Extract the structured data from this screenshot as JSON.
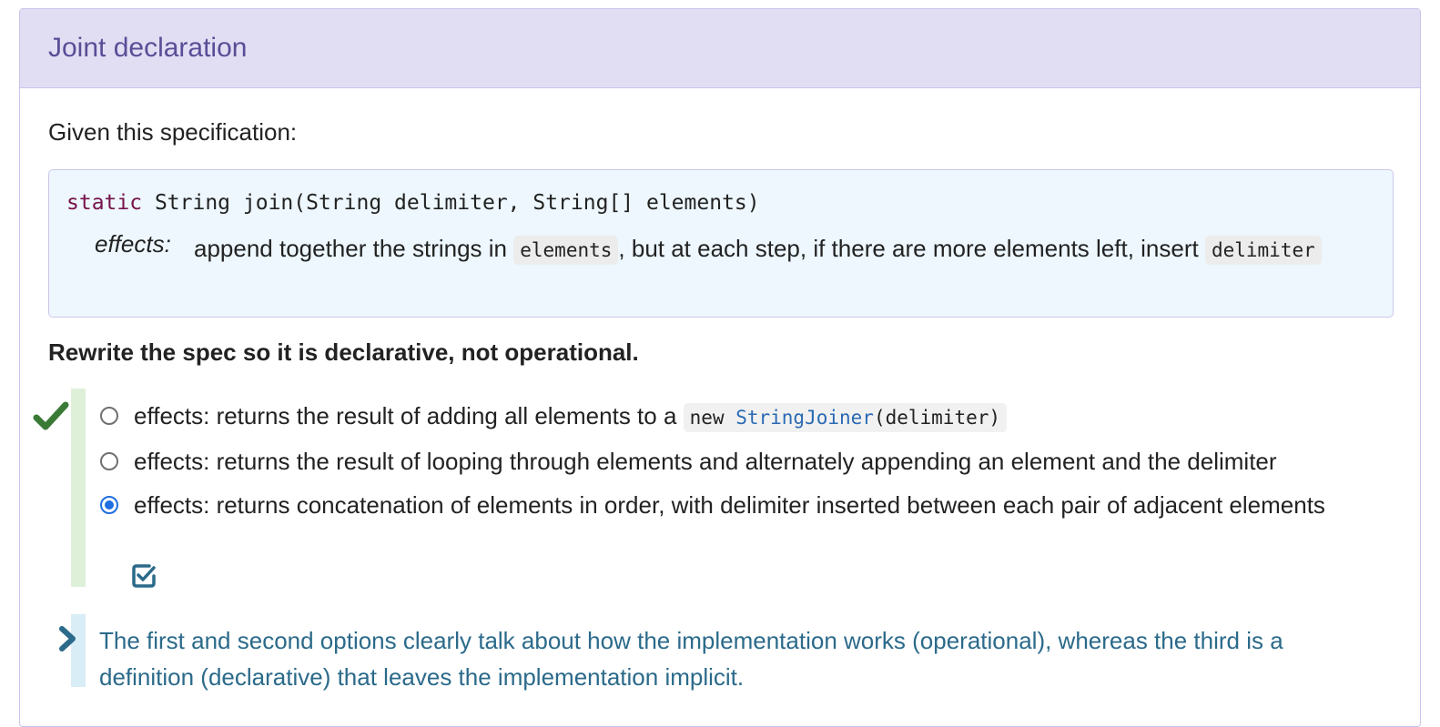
{
  "panel": {
    "title": "Joint declaration"
  },
  "intro": "Given this specification:",
  "spec": {
    "keyword": "static",
    "signature_rest": " String join(String delimiter, String[] elements)",
    "effects_label": "effects:",
    "effects_part1": "append together the strings in ",
    "effects_code1": "elements",
    "effects_part2": ", but at each step, if there are more elements left, insert ",
    "effects_code2": "delimiter"
  },
  "question": "Rewrite the spec so it is declarative, not operational.",
  "options": [
    {
      "text": "effects: returns the result of adding all elements to a ",
      "code_new": "new ",
      "code_class": "StringJoiner",
      "code_args": "(delimiter)",
      "selected": false
    },
    {
      "text": "effects: returns the result of looping through elements and alternately appending an element and the delimiter",
      "selected": false
    },
    {
      "text": "effects: returns concatenation of elements in order, with delimiter inserted between each pair of adjacent elements",
      "selected": true
    }
  ],
  "result": {
    "status": "correct",
    "status_color": "#3a7a36"
  },
  "explanation": "The first and second options clearly talk about how the implementation works (operational), whereas the third is a definition (declarative) that leaves the implementation implicit.",
  "icons": {
    "correct": "check-icon",
    "submit": "check-square-icon",
    "expand": "chevron-right-icon"
  },
  "colors": {
    "header_bg": "#e1def4",
    "title": "#5a4d96",
    "spec_bg": "#edf7fd",
    "answer_bar": "#dff0d8",
    "explain_bar": "#d9edf7",
    "explain_text": "#2b6a8a",
    "radio_selected": "#1f6fe0"
  }
}
